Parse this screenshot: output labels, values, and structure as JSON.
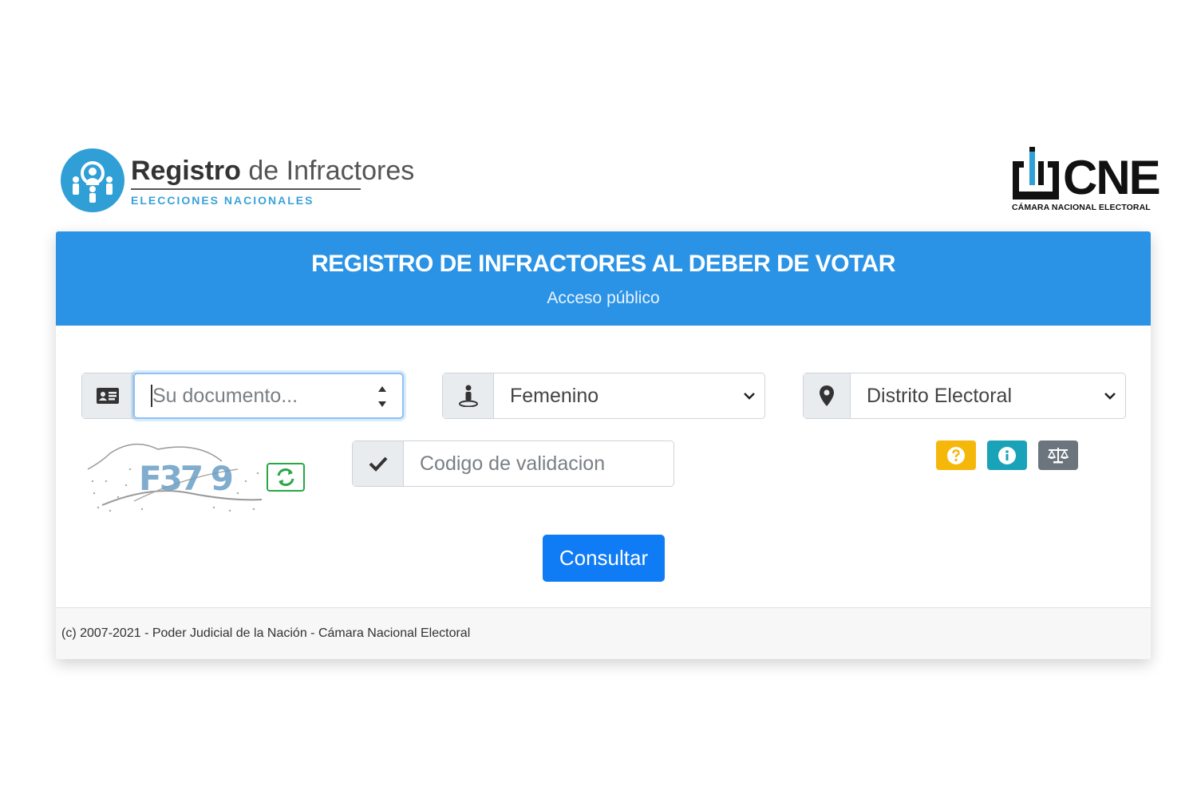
{
  "logo": {
    "title_bold": "Registro",
    "title_rest": " de Infractores",
    "subtitle": "ELECCIONES NACIONALES"
  },
  "cne": {
    "letters": "CNE",
    "caption": "CÁMARA NACIONAL ELECTORAL"
  },
  "card": {
    "title": "REGISTRO DE INFRACTORES AL DEBER DE VOTAR",
    "subtitle": "Acceso público"
  },
  "form": {
    "document_placeholder": "Su documento...",
    "gender_selected": "Femenino",
    "district_selected": "Distrito Electoral",
    "validation_placeholder": "Codigo de validacion",
    "captcha_text": "F37 9",
    "submit_label": "Consultar"
  },
  "help_buttons": [
    {
      "icon": "question-icon",
      "color": "#f5b70a"
    },
    {
      "icon": "info-icon",
      "color": "#1aa3b8"
    },
    {
      "icon": "scale-icon",
      "color": "#6c757d"
    }
  ],
  "colors": {
    "header_bg": "#2b93e6",
    "primary_button": "#0f7bf5",
    "refresh_border": "#28a745"
  },
  "footer": {
    "text": "(c) 2007-2021 - Poder Judicial de la Nación - Cámara Nacional Electoral"
  }
}
